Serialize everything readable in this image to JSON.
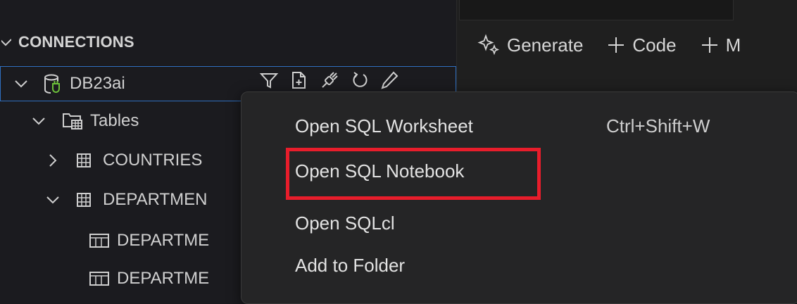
{
  "explorer": {
    "section_title": "CONNECTIONS",
    "connection": {
      "name": "DB23ai"
    },
    "tree": {
      "tables_label": "Tables",
      "items": [
        {
          "label": "COUNTRIES"
        },
        {
          "label": "DEPARTMEN"
        },
        {
          "label": "DEPARTME"
        },
        {
          "label": "DEPARTME"
        }
      ]
    }
  },
  "notebook_toolbar": {
    "generate_label": "Generate",
    "code_label": "Code",
    "markdown_label": "M"
  },
  "context_menu": {
    "items": [
      {
        "label": "Open SQL Worksheet",
        "shortcut": "Ctrl+Shift+W"
      },
      {
        "label": "Open SQL Notebook"
      },
      {
        "label": "Open SQLcl"
      },
      {
        "label": "Add to Folder"
      }
    ],
    "highlight_color": "#e81d2b"
  },
  "colors": {
    "background": "#1b1b1f",
    "menu_background": "#252526",
    "focus_border": "#2f6fc0",
    "connection_icon_accent": "#6cbf3a"
  }
}
